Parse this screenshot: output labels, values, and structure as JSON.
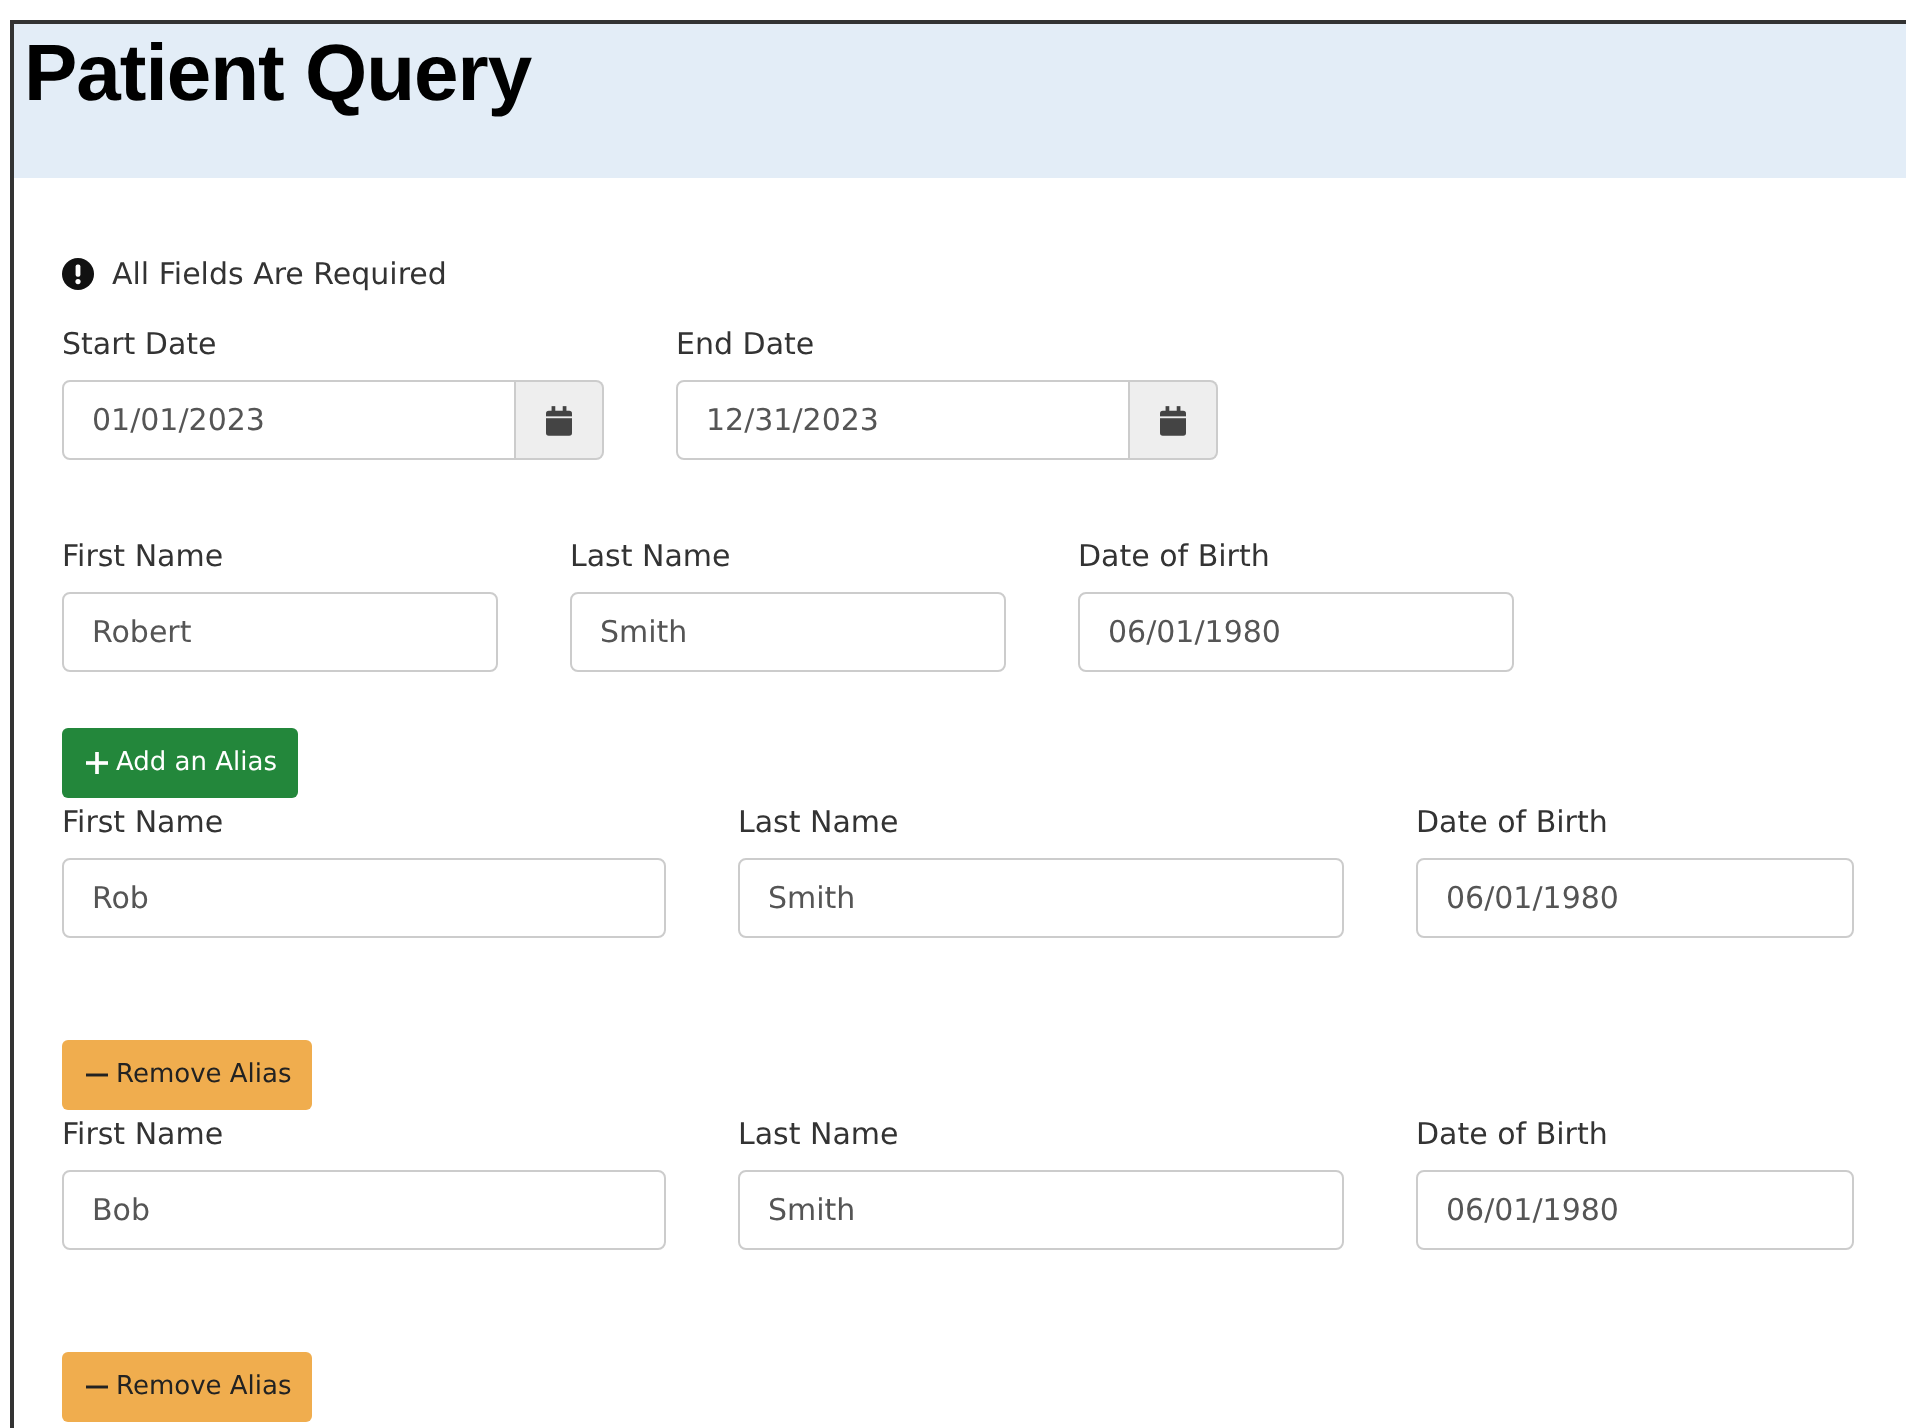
{
  "title": "Patient Query",
  "notice": "All Fields Are Required",
  "date_range": [
    {
      "label": "Start Date",
      "value": "01/01/2023"
    },
    {
      "label": "End Date",
      "value": "12/31/2023"
    }
  ],
  "patient": {
    "fields": [
      {
        "label": "First Name",
        "value": "Robert"
      },
      {
        "label": "Last Name",
        "value": "Smith"
      },
      {
        "label": "Date of Birth",
        "value": "06/01/1980"
      }
    ]
  },
  "add_alias_button": "Add an Alias",
  "aliases": [
    {
      "fields": [
        {
          "label": "First Name",
          "value": "Rob"
        },
        {
          "label": "Last Name",
          "value": "Smith"
        },
        {
          "label": "Date of Birth",
          "value": "06/01/1980"
        }
      ],
      "remove_button": "Remove Alias"
    },
    {
      "fields": [
        {
          "label": "First Name",
          "value": "Bob"
        },
        {
          "label": "Last Name",
          "value": "Smith"
        },
        {
          "label": "Date of Birth",
          "value": "06/01/1980"
        }
      ],
      "remove_button": "Remove Alias"
    }
  ]
}
